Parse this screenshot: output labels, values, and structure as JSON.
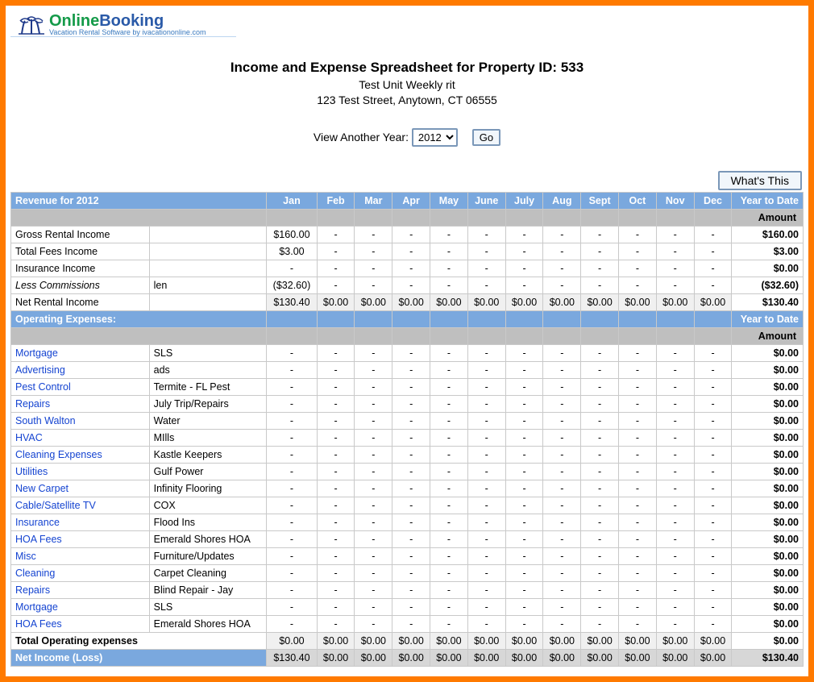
{
  "logo": {
    "text_part1": "Online",
    "text_part2": "Booking",
    "tagline": "Vacation Rental Software by ivacationonline.com"
  },
  "header": {
    "title": "Income and Expense Spreadsheet for Property ID: 533",
    "unit_name": "Test Unit Weekly rit",
    "address": "123 Test Street, Anytown, CT 06555"
  },
  "year_picker": {
    "label": "View Another Year:",
    "selected": "2012",
    "go": "Go"
  },
  "whats_this": "What's This",
  "months": [
    "Jan",
    "Feb",
    "Mar",
    "Apr",
    "May",
    "June",
    "July",
    "Aug",
    "Sept",
    "Oct",
    "Nov",
    "Dec"
  ],
  "section_labels": {
    "revenue_header": "Revenue for 2012",
    "ytd_header": "Year to Date",
    "amount_header": "Amount",
    "operating_header": "Operating Expenses:",
    "total_operating": "Total Operating expenses",
    "net_income": "Net Income (Loss)"
  },
  "revenue_rows": [
    {
      "label": "Gross Rental Income",
      "vendor": "",
      "jan": "$160.00",
      "rest": "-",
      "ytd": "$160.00",
      "link": false,
      "italic": false
    },
    {
      "label": "Total Fees Income",
      "vendor": "",
      "jan": "$3.00",
      "rest": "-",
      "ytd": "$3.00",
      "link": false,
      "italic": false
    },
    {
      "label": "Insurance Income",
      "vendor": "",
      "jan": "-",
      "rest": "-",
      "ytd": "$0.00",
      "link": false,
      "italic": false
    },
    {
      "label": "Less Commissions",
      "vendor": "len",
      "jan": "($32.60)",
      "rest": "-",
      "ytd": "($32.60)",
      "link": false,
      "italic": true
    }
  ],
  "net_rental": {
    "label": "Net Rental Income",
    "jan": "$130.40",
    "rest": "$0.00",
    "ytd": "$130.40"
  },
  "expense_rows": [
    {
      "label": "Mortgage",
      "vendor": "SLS",
      "ytd": "$0.00"
    },
    {
      "label": "Advertising",
      "vendor": "ads",
      "ytd": "$0.00"
    },
    {
      "label": "Pest Control",
      "vendor": "Termite - FL Pest",
      "ytd": "$0.00"
    },
    {
      "label": "Repairs",
      "vendor": "July Trip/Repairs",
      "ytd": "$0.00"
    },
    {
      "label": "South Walton",
      "vendor": "Water",
      "ytd": "$0.00"
    },
    {
      "label": "HVAC",
      "vendor": "MIlls",
      "ytd": "$0.00"
    },
    {
      "label": "Cleaning Expenses",
      "vendor": "Kastle Keepers",
      "ytd": "$0.00"
    },
    {
      "label": "Utilities",
      "vendor": "Gulf Power",
      "ytd": "$0.00"
    },
    {
      "label": "New Carpet",
      "vendor": "Infinity Flooring",
      "ytd": "$0.00"
    },
    {
      "label": "Cable/Satellite TV",
      "vendor": "COX",
      "ytd": "$0.00"
    },
    {
      "label": "Insurance",
      "vendor": "Flood Ins",
      "ytd": "$0.00"
    },
    {
      "label": "HOA Fees",
      "vendor": "Emerald Shores HOA",
      "ytd": "$0.00"
    },
    {
      "label": "Misc",
      "vendor": "Furniture/Updates",
      "ytd": "$0.00"
    },
    {
      "label": "Cleaning",
      "vendor": "Carpet Cleaning",
      "ytd": "$0.00"
    },
    {
      "label": "Repairs",
      "vendor": "Blind Repair - Jay",
      "ytd": "$0.00"
    },
    {
      "label": "Mortgage",
      "vendor": "SLS",
      "ytd": "$0.00"
    },
    {
      "label": "HOA Fees",
      "vendor": "Emerald Shores HOA",
      "ytd": "$0.00"
    }
  ],
  "total_operating": {
    "jan": "$0.00",
    "rest": "$0.00",
    "ytd": "$0.00"
  },
  "net_income": {
    "jan": "$130.40",
    "rest": "$0.00",
    "ytd": "$130.40"
  }
}
